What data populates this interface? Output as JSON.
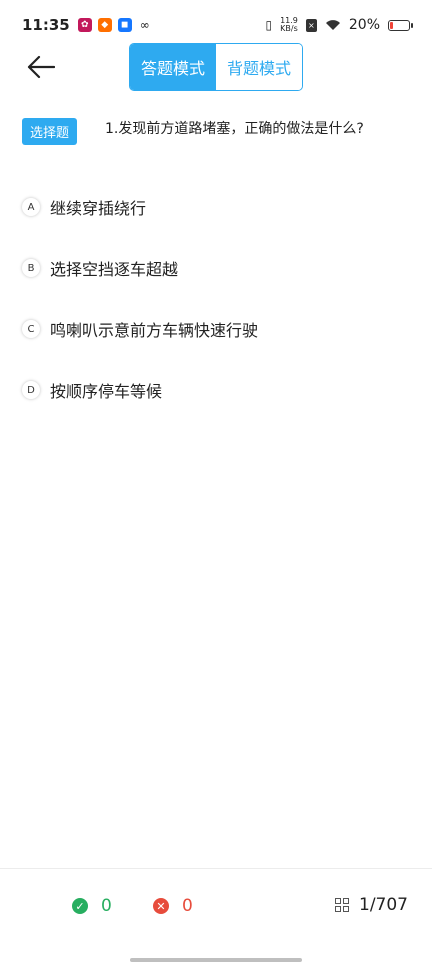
{
  "status_bar": {
    "time": "11:35",
    "net_speed_value": "11.9",
    "net_speed_unit": "KB/s",
    "battery_percent": "20%",
    "battery_level": 0.2
  },
  "header": {
    "mode_answer": "答题模式",
    "mode_memorize": "背题模式"
  },
  "question": {
    "type_label": "选择题",
    "text": "1.发现前方道路堵塞，正确的做法是什么?"
  },
  "options": [
    {
      "letter": "A",
      "text": "继续穿插绕行"
    },
    {
      "letter": "B",
      "text": "选择空挡逐车超越"
    },
    {
      "letter": "C",
      "text": "鸣喇叭示意前方车辆快速行驶"
    },
    {
      "letter": "D",
      "text": "按顺序停车等候"
    }
  ],
  "bottom": {
    "correct_count": "0",
    "wrong_count": "0",
    "progress": "1/707"
  },
  "colors": {
    "accent": "#2eaaf0",
    "correct": "#27ae60",
    "wrong": "#e74c3c"
  }
}
